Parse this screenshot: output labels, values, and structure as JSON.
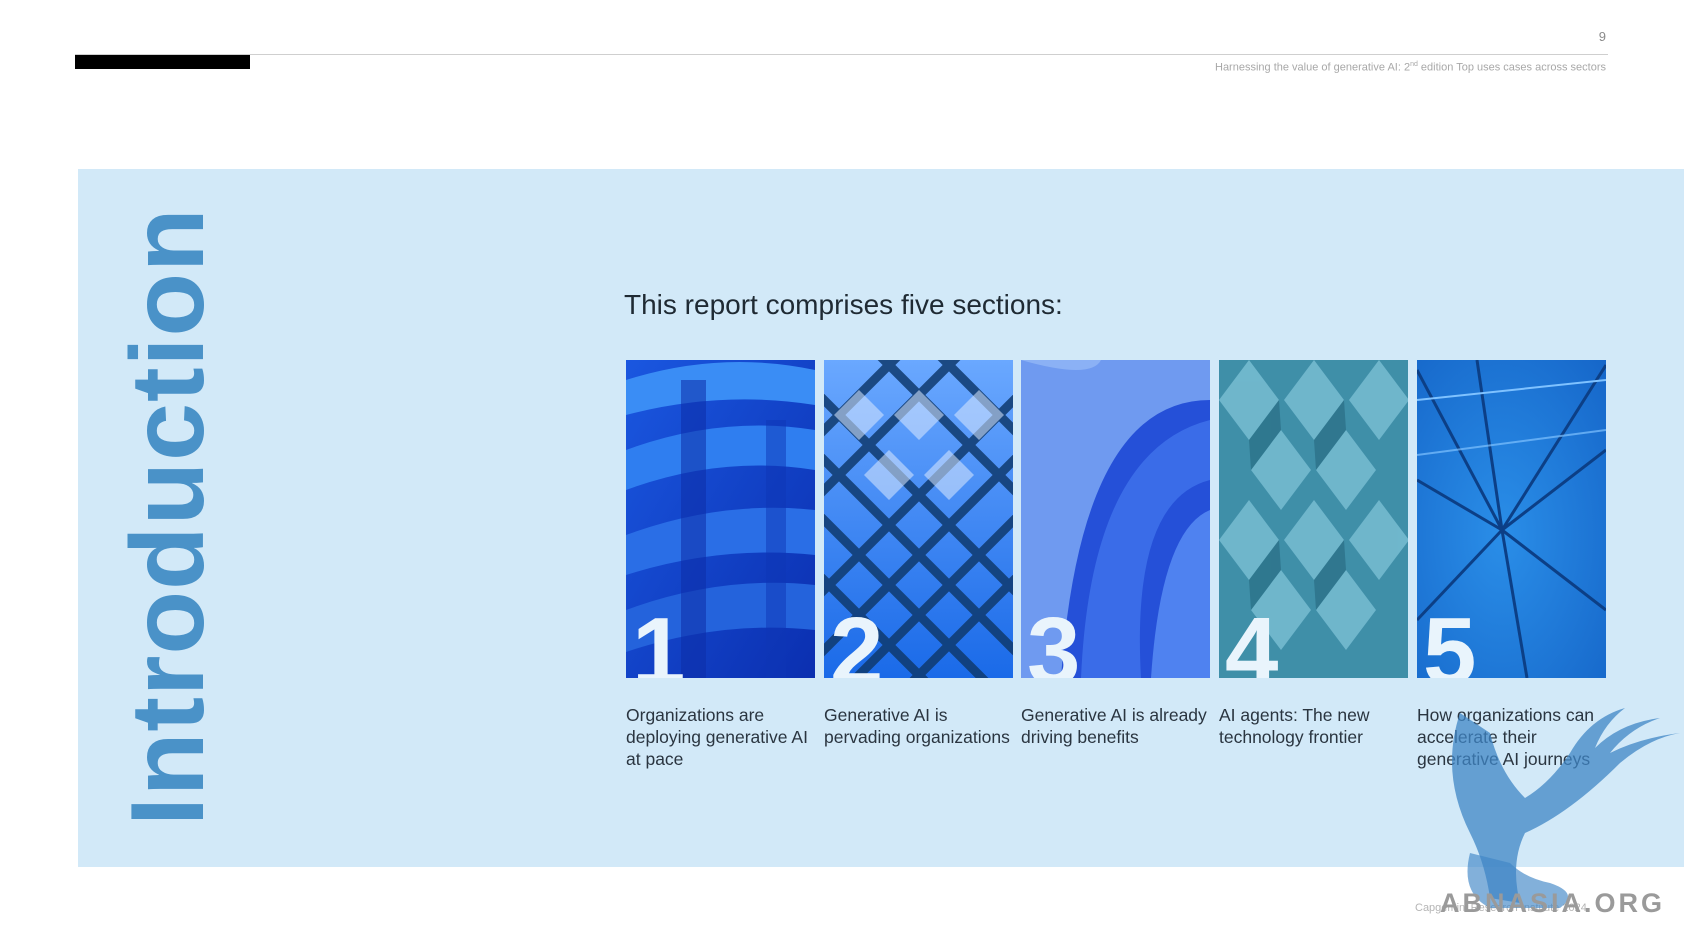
{
  "header": {
    "page_number": "9",
    "running_title_before_sup": "Harnessing the value of generative AI: 2",
    "running_title_sup": "nd",
    "running_title_after_sup": " edition Top uses cases across sectors"
  },
  "intro": {
    "vertical_title": "Introduction",
    "heading": "This report comprises five sections:"
  },
  "sections": [
    {
      "number": "1",
      "caption": "Organizations are deploying generative AI at pace"
    },
    {
      "number": "2",
      "caption": "Generative AI is pervading organizations"
    },
    {
      "number": "3",
      "caption": "Generative AI is already driving benefits"
    },
    {
      "number": "4",
      "caption": "AI agents: The new technology frontier"
    },
    {
      "number": "5",
      "caption": "How organizations can accelerate their generative AI journeys"
    }
  ],
  "footer": {
    "copyright_partial": "Capgemini Research Institute 2024",
    "watermark_text": "ABNASIA.ORG"
  },
  "colors": {
    "panel": "#d2e9f8",
    "title_blue": "#4a92c8",
    "top_bar": "#000000"
  }
}
